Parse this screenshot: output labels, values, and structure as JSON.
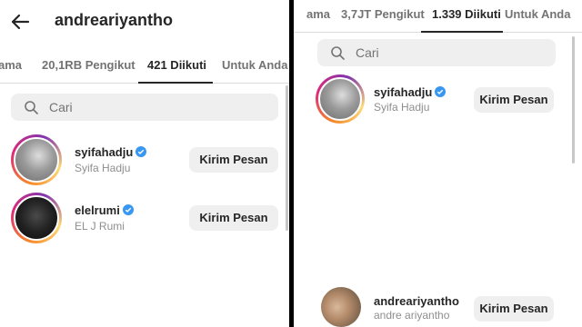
{
  "left_panel": {
    "header": {
      "username": "andreariyantho"
    },
    "tabs": [
      {
        "label": "ama",
        "active": false
      },
      {
        "label": "20,1RB Pengikut",
        "active": false
      },
      {
        "label": "421 Diikuti",
        "active": true
      },
      {
        "label": "Untuk Anda",
        "active": false
      }
    ],
    "search": {
      "placeholder": "Cari"
    },
    "list": [
      {
        "username": "syifahadju",
        "full_name": "Syifa Hadju",
        "verified": true,
        "button": "Kirim Pesan"
      },
      {
        "username": "elelrumi",
        "full_name": "EL J Rumi",
        "verified": true,
        "button": "Kirim Pesan"
      }
    ]
  },
  "right_panel": {
    "tabs": [
      {
        "label": "ama",
        "active": false
      },
      {
        "label": "3,7JT Pengikut",
        "active": false
      },
      {
        "label": "1.339 Diikuti",
        "active": true
      },
      {
        "label": "Untuk Anda",
        "active": false
      }
    ],
    "search": {
      "placeholder": "Cari"
    },
    "list": [
      {
        "username": "syifahadju",
        "full_name": "Syifa Hadju",
        "verified": true,
        "button": "Kirim Pesan"
      },
      {
        "username": "andreariyantho",
        "full_name": "andre ariyantho",
        "verified": false,
        "button": "Kirim Pesan"
      }
    ]
  },
  "colors": {
    "verified_badge": "#3897f0",
    "button_bg": "#efefef",
    "text_primary": "#262626",
    "text_secondary": "#8e8e8e"
  },
  "icons": [
    "back-arrow-icon",
    "search-icon",
    "verified-icon"
  ]
}
